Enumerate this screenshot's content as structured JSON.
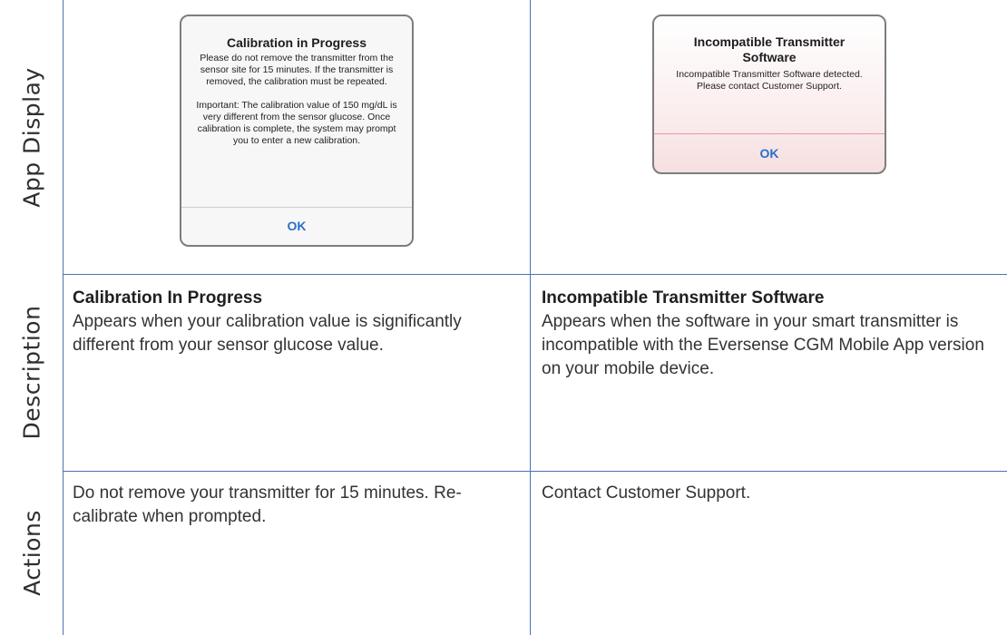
{
  "rows": {
    "app_display": "App Display",
    "description": "Description",
    "actions": "Actions"
  },
  "left": {
    "alert": {
      "title": "Calibration in Progress",
      "message": "Please do not remove the transmitter from the sensor site for 15 minutes. If the transmitter is removed, the calibration must be repeated.\n\nImportant: The calibration value of 150 mg/dL is very different from the sensor glucose. Once calibration is complete, the system may prompt you to enter a new calibration.",
      "button": "OK"
    },
    "description_title": "Calibration In Progress",
    "description_text": "Appears when your calibration value is significantly different from your sensor glucose value.",
    "actions_text": "Do not remove your transmitter for 15 minutes. Re-calibrate when prompted."
  },
  "right": {
    "alert": {
      "title": "Incompatible Transmitter Software",
      "message": "Incompatible Transmitter Software detected. Please contact Customer Support.",
      "button": "OK"
    },
    "description_title": "Incompatible Transmitter Software",
    "description_text": "Appears when the software in your smart transmitter is incompatible with the Eversense CGM Mobile App version on your mobile device.",
    "actions_text": "Contact Customer Support."
  },
  "colors": {
    "grid_line": "#4b72b8",
    "ok_button": "#2a6fc9",
    "alert_tint": "#f6dfe0"
  }
}
